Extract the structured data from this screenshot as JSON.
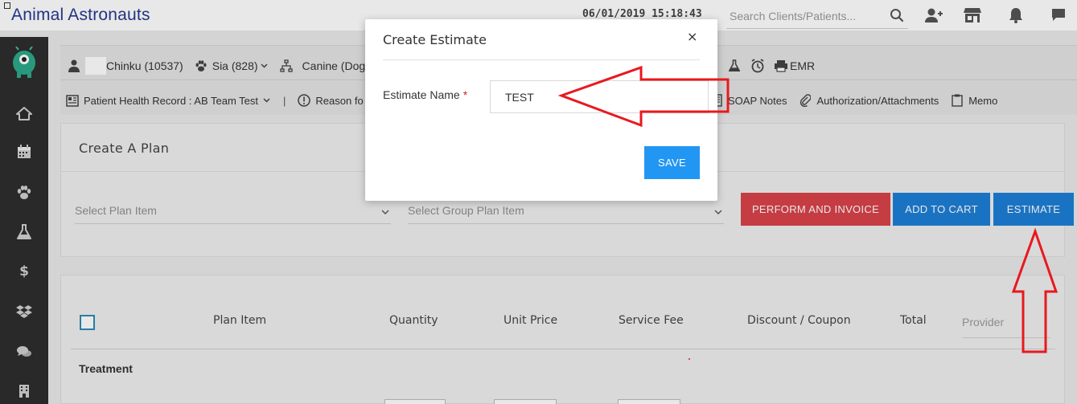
{
  "app": {
    "title": "Animal Astronauts",
    "datetime": "06/01/2019 15:18:43",
    "search_placeholder": "Search Clients/Patients..."
  },
  "topbar_icons": [
    "search-icon",
    "add-user-icon",
    "store-icon",
    "bell-icon",
    "chat-icon"
  ],
  "sidebar": {
    "items": [
      "home-icon",
      "calendar-icon",
      "paw-icon",
      "flask-icon",
      "dollar-icon",
      "dropbox-icon",
      "comments-icon",
      "building-icon"
    ]
  },
  "patient_band": {
    "client_label": "Chinku (10537)",
    "patient_label": "Sia (828)",
    "species_label": "Canine (Dog)",
    "emr_label": "EMR",
    "record_label": "Patient Health Record : AB Team Test",
    "divider": "|",
    "reason_label": "Reason fo",
    "soap_label": "SOAP Notes",
    "auth_label": "Authorization/Attachments",
    "memo_label": "Memo"
  },
  "plan": {
    "title": "Create A Plan",
    "select_item_placeholder": "Select Plan Item",
    "select_group_placeholder": "Select Group Plan Item",
    "btn_perform": "PERFORM AND INVOICE",
    "btn_cart": "ADD TO CART",
    "btn_estimate": "ESTIMATE",
    "colors": {
      "perform": "#d9434a",
      "cart": "#1d7fd6",
      "estimate": "#1d7fd6"
    }
  },
  "table": {
    "columns": [
      "Plan Item",
      "Quantity",
      "Unit Price",
      "Service Fee",
      "Discount / Coupon",
      "Total"
    ],
    "provider_placeholder": "Provider",
    "section": "Treatment"
  },
  "modal": {
    "title": "Create Estimate",
    "close": "×",
    "field_label": "Estimate Name",
    "required_mark": "*",
    "field_value": "TEST",
    "save_label": "SAVE",
    "save_color": "#2196f3"
  },
  "annotation_color": "#e8191e"
}
